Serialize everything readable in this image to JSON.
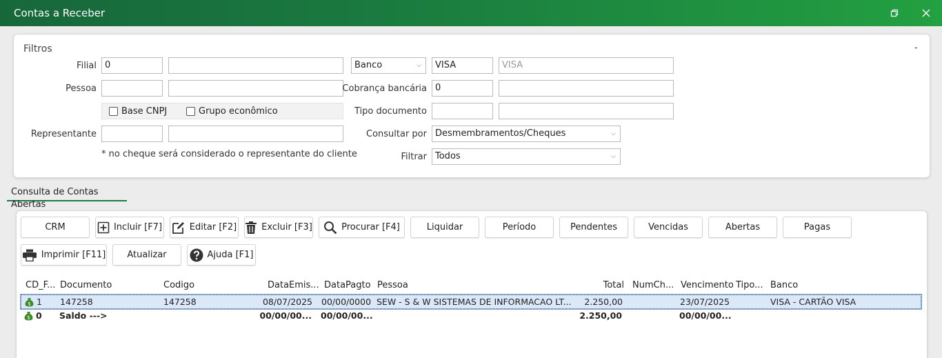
{
  "window": {
    "title": "Contas a Receber"
  },
  "filters": {
    "title": "Filtros",
    "collapse": "-",
    "filial_label": "Filial",
    "filial_code": "0",
    "filial_name": "",
    "pessoa_label": "Pessoa",
    "pessoa_code": "",
    "pessoa_name": "",
    "base_cnpj": "Base CNPJ",
    "grupo_economico": "Grupo econômico",
    "representante_label": "Representante",
    "representante_code": "",
    "representante_name": "",
    "note": "* no cheque será considerado o representante do cliente",
    "banco_select": "Banco",
    "banco_code": "VISA",
    "banco_name": "VISA",
    "cobranca_label": "Cobrança bancária",
    "cobranca_code": "0",
    "cobranca_name": "",
    "tipo_doc_label": "Tipo documento",
    "tipo_doc_code": "",
    "tipo_doc_name": "",
    "consultar_label": "Consultar por",
    "consultar_value": "Desmembramentos/Cheques",
    "filtrar_label": "Filtrar",
    "filtrar_value": "Todos"
  },
  "tab": {
    "label": "Consulta de Contas Abertas"
  },
  "toolbar": {
    "crm": "CRM",
    "incluir": "Incluir [F7]",
    "editar": "Editar [F2]",
    "excluir": "Excluir [F3]",
    "procurar": "Procurar [F4]",
    "liquidar": "Liquidar",
    "periodo": "Período",
    "pendentes": "Pendentes",
    "vencidas": "Vencidas",
    "abertas": "Abertas",
    "pagas": "Pagas",
    "imprimir": "Imprimir [F11]",
    "atualizar": "Atualizar",
    "ajuda": "Ajuda [F1]"
  },
  "grid": {
    "columns": [
      "CD_F...",
      "Documento",
      "Codigo",
      "DataEmis...",
      "DataPagto",
      "Pessoa",
      "Total",
      "NumCh...",
      "Vencimento",
      "Tipo...",
      "Banco"
    ],
    "rows": [
      {
        "cd": "1",
        "documento": "147258",
        "codigo": "147258",
        "data_emissao": "08/07/2025",
        "data_pagto": "00/00/0000",
        "pessoa": "SEW - S & W SISTEMAS DE INFORMACAO LT...",
        "total": "2.250,00",
        "num_cheque": "",
        "vencimento": "23/07/2025",
        "tipo": "",
        "banco": "VISA - CARTÃO VISA"
      },
      {
        "cd": "0",
        "documento": "Saldo --->",
        "codigo": "",
        "data_emissao": "00/00/00...",
        "data_pagto": "00/00/00...",
        "pessoa": "",
        "total": "2.250,00",
        "num_cheque": "",
        "vencimento": "00/00/00...",
        "tipo": "",
        "banco": ""
      }
    ]
  },
  "colors": {
    "titlebar": "#1a7a3f",
    "accent": "#1a7a3f",
    "selection": "#dbe8f7"
  }
}
